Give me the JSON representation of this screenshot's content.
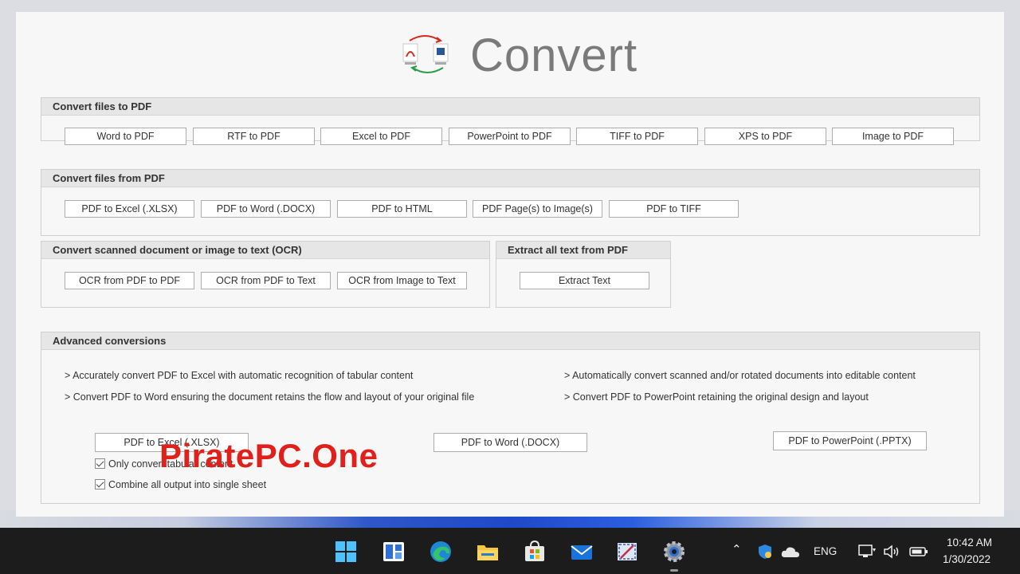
{
  "app": {
    "title": "Convert"
  },
  "groups": {
    "to_pdf": {
      "title": "Convert files to PDF",
      "buttons": [
        "Word to PDF",
        "RTF to PDF",
        "Excel to PDF",
        "PowerPoint to PDF",
        "TIFF to PDF",
        "XPS to PDF",
        "Image to PDF"
      ]
    },
    "from_pdf": {
      "title": "Convert files from PDF",
      "buttons": [
        "PDF to Excel (.XLSX)",
        "PDF to Word (.DOCX)",
        "PDF to HTML",
        "PDF Page(s) to Image(s)",
        "PDF to TIFF"
      ]
    },
    "ocr": {
      "title": "Convert scanned document or image to text (OCR)",
      "buttons": [
        "OCR from PDF to PDF",
        "OCR from PDF to Text",
        "OCR from Image to Text"
      ]
    },
    "extract": {
      "title": "Extract all text from PDF",
      "buttons": [
        "Extract Text"
      ]
    },
    "advanced": {
      "title": "Advanced conversions",
      "features": [
        "> Accurately convert PDF to Excel with automatic recognition of tabular content",
        "> Convert PDF to Word ensuring the document retains the flow and layout of your original file",
        "> Automatically convert scanned and/or rotated documents into editable content",
        "> Convert PDF to PowerPoint retaining the original design and layout"
      ],
      "buttons": [
        "PDF to Excel (.XLSX)",
        "PDF to Word (.DOCX)",
        "PDF to PowerPoint (.PPTX)"
      ],
      "options": [
        {
          "label": "Only convert tabular content",
          "checked": true
        },
        {
          "label": "Combine all output into single sheet",
          "checked": true
        }
      ]
    }
  },
  "watermark": "PiratePC.One",
  "taskbar": {
    "icons": [
      "start-icon",
      "widgets-icon",
      "edge-icon",
      "file-explorer-icon",
      "store-icon",
      "mail-icon",
      "snipping-tool-icon",
      "settings-icon"
    ],
    "language": "ENG",
    "time": "10:42 AM",
    "date": "1/30/2022"
  },
  "colors": {
    "accent_red": "#e0201b",
    "taskbar": "#1c1c1c",
    "title_gray": "#7a7a7a"
  }
}
